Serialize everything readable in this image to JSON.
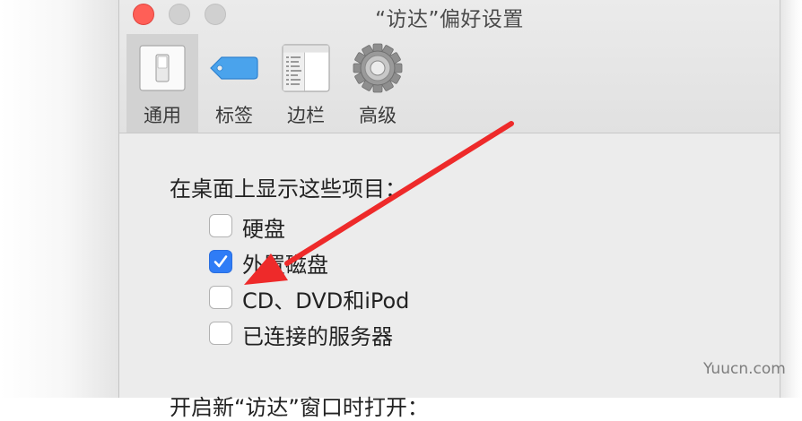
{
  "window": {
    "title": "“访达”偏好设置"
  },
  "toolbar": {
    "tabs": [
      {
        "label": "通用"
      },
      {
        "label": "标签"
      },
      {
        "label": "边栏"
      },
      {
        "label": "高级"
      }
    ],
    "active_tab": "通用"
  },
  "general": {
    "desktop_section_label": "在桌面上显示这些项目：",
    "options": [
      {
        "label": "硬盘",
        "checked": false
      },
      {
        "label": "外置磁盘",
        "checked": true
      },
      {
        "label": "CD、DVD和iPod",
        "checked": false
      },
      {
        "label": "已连接的服务器",
        "checked": false
      }
    ],
    "new_window_label": "开启新“访达”窗口时打开："
  },
  "annotation": {
    "arrow_color": "#ee2a2a"
  },
  "watermark": "Yuucn.com",
  "colors": {
    "accent": "#2f7cf6",
    "close": "#ff5f57"
  }
}
